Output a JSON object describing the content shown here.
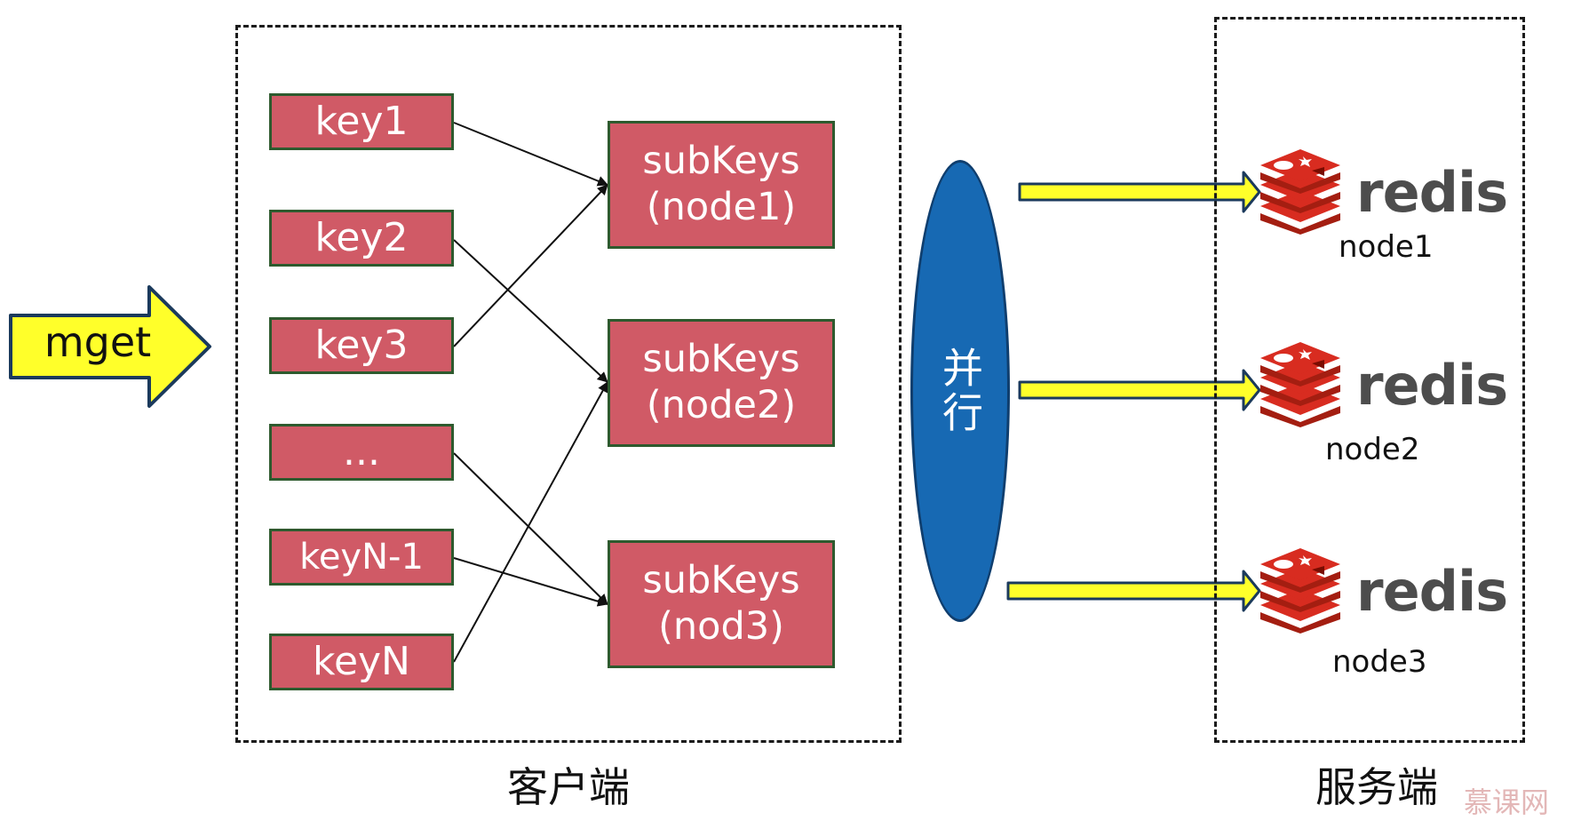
{
  "input": {
    "label": "mget"
  },
  "client": {
    "label": "客户端",
    "keys": [
      "key1",
      "key2",
      "key3",
      "...",
      "keyN-1",
      "keyN"
    ],
    "subkeys": [
      {
        "line1": "subKeys",
        "line2": "(node1)"
      },
      {
        "line1": "subKeys",
        "line2": "(node2)"
      },
      {
        "line1": "subKeys",
        "line2": "(nod3)"
      }
    ]
  },
  "parallel": {
    "label": "并行"
  },
  "server": {
    "label": "服务端",
    "nodes": [
      {
        "logo_text": "redis",
        "name": "node1"
      },
      {
        "logo_text": "redis",
        "name": "node2"
      },
      {
        "logo_text": "redis",
        "name": "node3"
      }
    ]
  },
  "watermark": "慕课网",
  "colors": {
    "key_fill": "#d05a66",
    "box_border": "#2e5a2e",
    "parallel_fill": "#1769b3",
    "arrow_fill": "#ffff2a",
    "redis_red": "#d82c20",
    "redis_text": "#4d4d4d"
  },
  "icons": {
    "redis": "redis-stack-icon"
  }
}
